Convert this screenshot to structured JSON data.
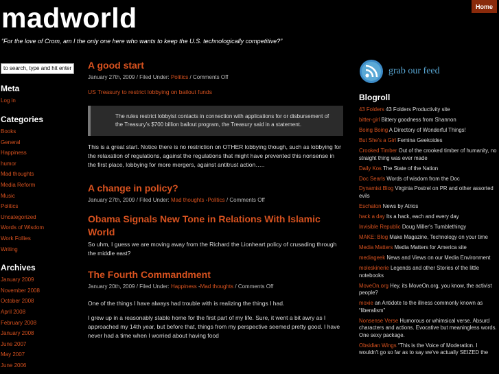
{
  "header": {
    "title": "madworld",
    "tagline": "“For the love of Crom, am I the only one here who wants to keep the U.S. technologically competitive?”",
    "home_label": "Home"
  },
  "search": {
    "value": "to search, type and hit enter"
  },
  "meta": {
    "heading": "Meta",
    "items": [
      "Log in"
    ]
  },
  "categories": {
    "heading": "Categories",
    "items": [
      "Books",
      "General",
      "Happiness",
      "humor",
      "Mad thoughts",
      "Media Reform",
      "Music",
      "Politics",
      "Uncategorized",
      "Words of Wisdom",
      "Work Follies",
      "Writing"
    ]
  },
  "archives": {
    "heading": "Archives",
    "items": [
      "January 2009",
      "November 2008",
      "October 2008",
      "April 2008",
      "February 2008",
      "January 2008",
      "June 2007",
      "May 2007",
      "June 2006"
    ]
  },
  "posts": [
    {
      "title": "A good start",
      "meta_prefix": "January 27th, 2009 / Filed Under: ",
      "cats": [
        "Politics"
      ],
      "meta_suffix": " / Comments Off",
      "link": "US Treasury to restrict lobbying on bailout funds",
      "quote": "The rules restrict lobbyist contacts in connection with applications for or disbursement of the Treasury’s $700 billion bailout program, the Treasury said in a statement.",
      "body": "This is a great start.  Notice there is no restriction on OTHER lobbying though, such as lobbying for the relaxation of regulations, against the regulations that might have prevented this nonsense in the first place, lobbying for more mergers, against antitrust action….."
    },
    {
      "title": "A change in policy?",
      "meta_prefix": "January 27th, 2009 / Filed Under: ",
      "cats": [
        "Mad thoughts",
        "Politics"
      ],
      "meta_suffix": " / Comments Off"
    },
    {
      "title": "Obama Signals New Tone in Relations With Islamic World",
      "body": "So uhm, I guess we are moving away from the Richard the Lionheart policy of crusading through the middle east?"
    },
    {
      "title": "The Fourth Commandment",
      "meta_prefix": "January 20th, 2009 / Filed Under: ",
      "cats": [
        "Happiness",
        "Mad thoughts"
      ],
      "meta_suffix": " / Comments Off",
      "p1": "One of the things I have always had trouble with is realizing the things I had.",
      "p2": "I grew up in a reasonably stable home for the first part of my life. Sure, it went a bit awry as I approached my 14th year, but before that, things from my perspective seemed pretty good. I have never had a time when I worried about having food"
    }
  ],
  "feed": {
    "label": "grab our feed"
  },
  "blogroll": {
    "heading": "Blogroll",
    "items": [
      {
        "name": "43 Folders",
        "desc": " 43 Folders Productivity site"
      },
      {
        "name": "bitter-girl",
        "desc": " Bittery goodness from Shannon"
      },
      {
        "name": "Boing Boing",
        "desc": " A Directory of Wonderful Things!"
      },
      {
        "name": "But She's a Girl",
        "desc": " Femina Geekoides"
      },
      {
        "name": "Crooked Timber",
        "desc": " Out of the crooked timber of humanity, no straight thing was ever made"
      },
      {
        "name": "Daily Kos",
        "desc": " The State of the Nation"
      },
      {
        "name": "Doc Searls",
        "desc": " Words of wisdom from the Doc"
      },
      {
        "name": "Dynamist Blog",
        "desc": " Virginia Postrel on PR and other assorted evils"
      },
      {
        "name": "Eschaton",
        "desc": " News by Atrios"
      },
      {
        "name": "hack a day",
        "desc": " Its a hack, each and every day"
      },
      {
        "name": "Invisible Republic",
        "desc": " Doug Miller's Tumblethingy"
      },
      {
        "name": "MAKE: Blog",
        "desc": " Make Magazine, Technology on your time"
      },
      {
        "name": "Media Matters",
        "desc": " Media Matters for America site"
      },
      {
        "name": "mediageek",
        "desc": " News and Views on our Media Environment"
      },
      {
        "name": "moleskinerie",
        "desc": " Legends and other Stories of the little notebooks"
      },
      {
        "name": "MoveOn.org",
        "desc": " Hey, its MoveOn.org, you know, the activist people?"
      },
      {
        "name": "moxie",
        "desc": " an Antidote to the illness commonly known as “liberalism”"
      },
      {
        "name": "Nonsense Verse",
        "desc": " Humorous or whimsical verse. Absurd characters and actions. Evocative but meaningless words. One sexy package."
      },
      {
        "name": "Obsidian Wings",
        "desc": " “This is the Voice of Moderation. I wouldn't go so far as to say we've actually SEIZED the"
      }
    ]
  },
  "colors": {
    "accent": "#d8521f",
    "background": "#000000",
    "home_button": "#8a2a0b",
    "feed_blue": "#5aa9d6"
  }
}
